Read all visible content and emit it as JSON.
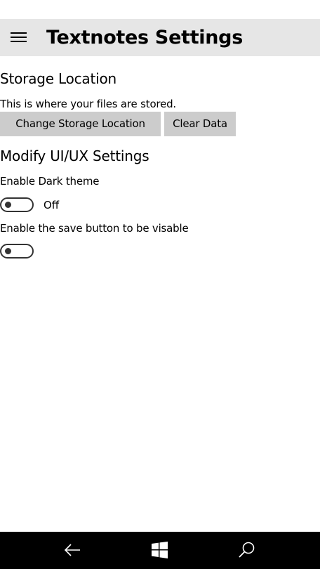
{
  "header": {
    "menu_icon": "hamburger-menu-icon",
    "title": "Textnotes Settings"
  },
  "storage": {
    "heading": "Storage Location",
    "description": "This is where your files are stored.",
    "change_button_label": "Change Storage Location",
    "clear_button_label": "Clear Data"
  },
  "ui_settings": {
    "heading": "Modify UI/UX Settings",
    "dark_theme": {
      "label": "Enable Dark theme",
      "state_text": "Off",
      "enabled": false
    },
    "save_button": {
      "label": "Enable the save button to be visable",
      "enabled": false
    }
  },
  "navbar": {
    "back_icon": "back-arrow-icon",
    "home_icon": "windows-logo-icon",
    "search_icon": "search-icon"
  },
  "colors": {
    "header_bg": "#e6e6e6",
    "button_bg": "#cccccc",
    "navbar_bg": "#000000"
  }
}
